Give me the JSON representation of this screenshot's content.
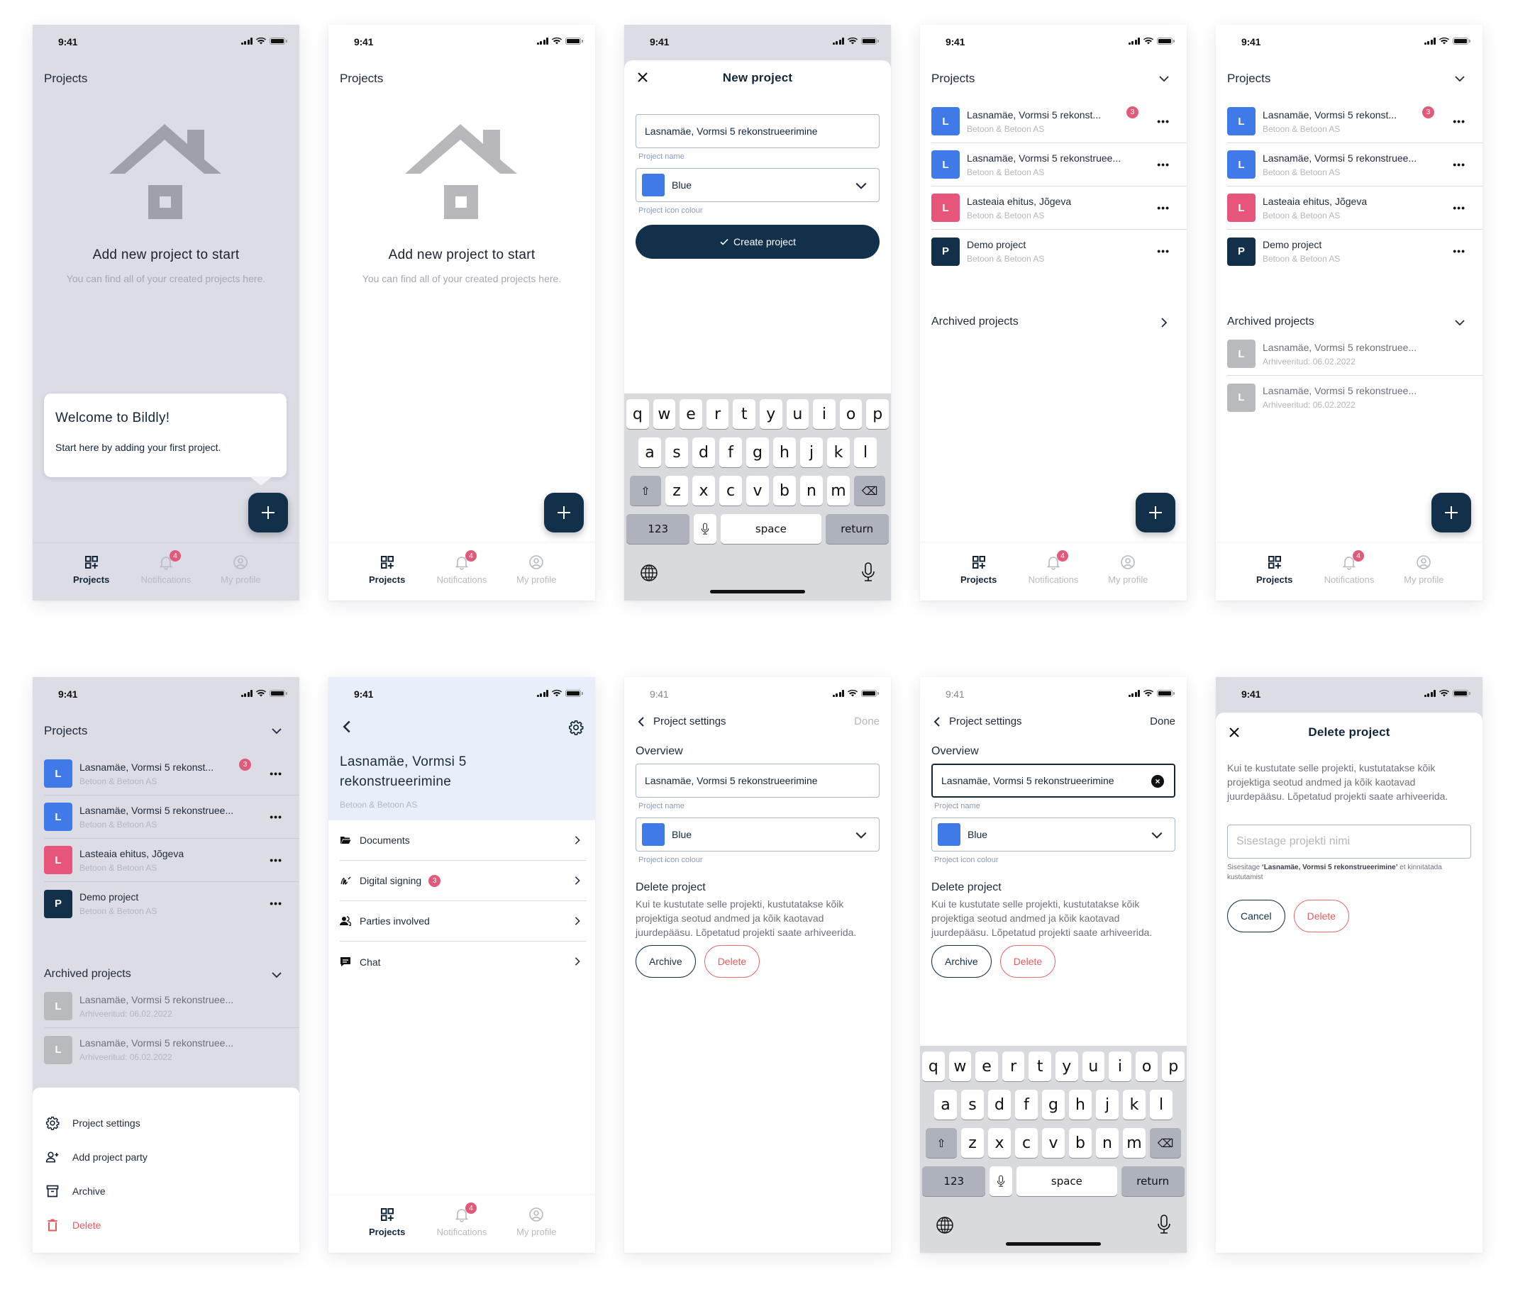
{
  "status": {
    "time": "9:41"
  },
  "nav": {
    "items": [
      {
        "label": "Projects",
        "icon": "projects-grid-icon"
      },
      {
        "label": "Notifications",
        "icon": "bell-icon",
        "badge": "4"
      },
      {
        "label": "My profile",
        "icon": "user-circle-icon"
      }
    ]
  },
  "colors": {
    "primary": "#12304a",
    "blue": "#3f7ae8",
    "pink": "#e8557a",
    "navy": "#12304a",
    "archived": "#b9babe",
    "danger": "#e45b5b",
    "badge": "#e25a7a"
  },
  "screen1": {
    "title": "Projects",
    "empty_title": "Add new project to start",
    "empty_text": "You can find all of your created projects here.",
    "tooltip_title": "Welcome to Bildly!",
    "tooltip_text": "Start here by adding your first project."
  },
  "screen2": {
    "title": "Projects",
    "empty_title": "Add new project to start",
    "empty_text": "You can find all of your created projects here."
  },
  "screen3": {
    "modal_title": "New project",
    "name_value": "Lasnamäe, Vormsi 5 rekonstrueerimine",
    "name_hint": "Project name",
    "colour_value": "Blue",
    "colour_hint": "Project icon colour",
    "create_label": "Create project"
  },
  "keyboard": {
    "row1": [
      "q",
      "w",
      "e",
      "r",
      "t",
      "y",
      "u",
      "i",
      "o",
      "p"
    ],
    "row2": [
      "a",
      "s",
      "d",
      "f",
      "g",
      "h",
      "j",
      "k",
      "l"
    ],
    "row3": [
      "z",
      "x",
      "c",
      "v",
      "b",
      "n",
      "m"
    ],
    "num_label": "123",
    "space_label": "space",
    "return_label": "return"
  },
  "projects": {
    "title": "Projects",
    "items": [
      {
        "initial": "L",
        "name": "Lasnamäe, Vormsi 5 rekonst...",
        "company": "Betoon & Betoon AS",
        "badge": "3",
        "color": "#3f7ae8"
      },
      {
        "initial": "L",
        "name": "Lasnamäe, Vormsi 5 rekonstruee...",
        "company": "Betoon & Betoon AS",
        "color": "#3f7ae8"
      },
      {
        "initial": "L",
        "name": "Lasteaia ehitus, Jõgeva",
        "company": "Betoon & Betoon AS",
        "color": "#e8557a"
      },
      {
        "initial": "P",
        "name": "Demo project",
        "company": "Betoon & Betoon AS",
        "color": "#12304a"
      }
    ],
    "more_label": "•••",
    "archived_title": "Archived projects",
    "archived": [
      {
        "initial": "L",
        "name": "Lasnamäe, Vormsi 5 rekonstruee...",
        "date": "Arhiveeritud: 06.02.2022"
      },
      {
        "initial": "L",
        "name": "Lasnamäe, Vormsi 5 rekonstruee...",
        "date": "Arhiveeritud: 06.02.2022"
      }
    ]
  },
  "sheet": {
    "items": [
      {
        "label": "Project settings",
        "icon": "gear-icon"
      },
      {
        "label": "Add project party",
        "icon": "user-plus-icon"
      },
      {
        "label": "Archive",
        "icon": "archive-box-icon"
      },
      {
        "label": "Delete",
        "icon": "trash-icon"
      }
    ]
  },
  "detail": {
    "title": "Lasnamäe, Vormsi 5 rekonstrueerimine",
    "company": "Betoon & Betoon AS",
    "menu": [
      {
        "label": "Documents",
        "icon": "folder-icon"
      },
      {
        "label": "Digital signing",
        "icon": "signature-icon",
        "badge": "3"
      },
      {
        "label": "Parties involved",
        "icon": "users-icon"
      },
      {
        "label": "Chat",
        "icon": "chat-icon"
      }
    ]
  },
  "settings": {
    "title": "Project settings",
    "done_label": "Done",
    "overview_label": "Overview",
    "name_value": "Lasnamäe, Vormsi 5 rekonstrueerimine",
    "name_hint": "Project name",
    "colour_value": "Blue",
    "colour_hint": "Project icon colour",
    "delete_heading": "Delete project",
    "delete_text": "Kui te kustutate selle projekti, kustutatakse kõik projektiga seotud andmed ja kõik kaotavad juurdepääsu. Lõpetatud projekti saate arhiveerida.",
    "archive_label": "Archive",
    "delete_label": "Delete"
  },
  "delete_dialog": {
    "title": "Delete project",
    "text": "Kui te kustutate selle projekti, kustutatakse kõik projektiga seotud andmed ja kõik kaotavad juurdepääsu. Lõpetatud projekti saate arhiveerida.",
    "placeholder": "Sisestage projekti nimi",
    "help_prefix": "Sisesitage ",
    "help_name": "‘Lasnamäe, Vormsi 5 rekonstrueerimine’",
    "help_suffix": " et kinnitatada kustutamist",
    "cancel_label": "Cancel",
    "delete_label": "Delete"
  }
}
